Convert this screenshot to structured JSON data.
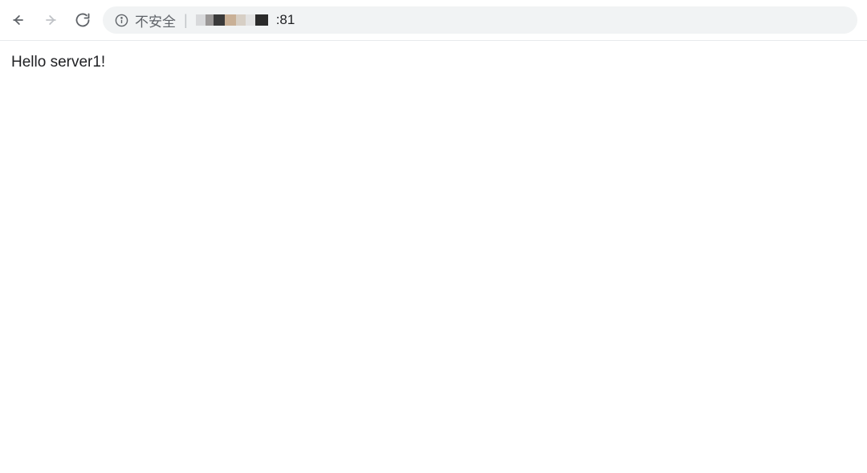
{
  "toolbar": {
    "security_label": "不安全",
    "port_suffix": ":81"
  },
  "page": {
    "body_text": "Hello server1!"
  }
}
